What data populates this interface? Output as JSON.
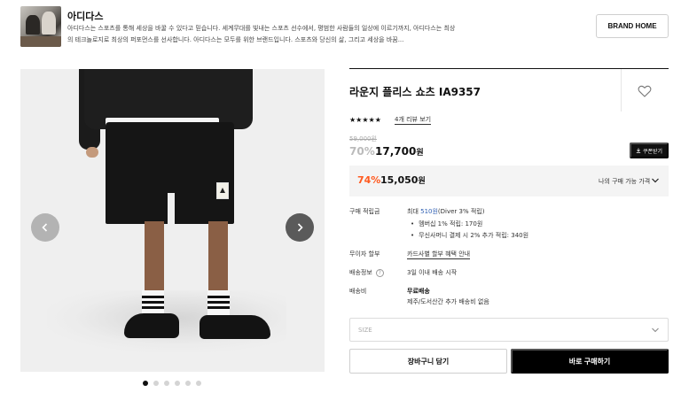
{
  "brand": {
    "name": "아디다스",
    "description": "아디다스는 스포츠를 통해 세상을 바꿀 수 있다고 믿습니다. 세계무대를 빛내는 스포츠 선수에서, 평범한 사람들의 일상에 이르기까지, 아디다스는 최상의 테크놀로지로 최상의 퍼포먼스를 선사합니다. 아디다스는 모두를 위한 브랜드입니다. 스포츠와 당신의 삶, 그리고 세상을 바꿈...",
    "home_button": "BRAND HOME"
  },
  "gallery": {
    "prev_icon": "chevron-left-icon",
    "next_icon": "chevron-right-icon",
    "dot_count": 6,
    "active_index": 0
  },
  "product": {
    "title": "라운지 플리스 쇼츠 IA9357",
    "rating_stars": "★★★★★",
    "rating_value": 5,
    "review_link": "4개 리뷰 보기",
    "original_price": "59,000원",
    "discount_pct": "70%",
    "sale_price": "17,700",
    "won": "원",
    "coupon_button": "쿠폰받기",
    "best": {
      "pct": "74%",
      "price": "15,050",
      "won": "원",
      "label": "나의 구매 가능 가격"
    }
  },
  "details": {
    "points": {
      "label": "구매 적립금",
      "prefix": "최대 ",
      "amount": "510원",
      "suffix": "(Diver 3% 적립)",
      "bullet1": "멤버십 1% 적립: 170원",
      "bullet2": "무신사머니 결제 시 2% 추가 적립: 340원"
    },
    "installment": {
      "label": "무이자 할부",
      "value": "카드사별 할부 혜택 안내"
    },
    "shipping_info": {
      "label": "배송정보",
      "help": "?",
      "value": "3일 이내 배송 시작"
    },
    "shipping_fee": {
      "label": "배송비",
      "value": "무료배송",
      "note": "제주/도서산간 추가 배송비 없음"
    }
  },
  "size": {
    "placeholder": "SIZE"
  },
  "actions": {
    "cart": "장바구니 담기",
    "buy": "바로 구매하기"
  },
  "colors": {
    "accent_orange": "#ff5a1f",
    "link_blue": "#2f5fb3",
    "black": "#000000"
  }
}
